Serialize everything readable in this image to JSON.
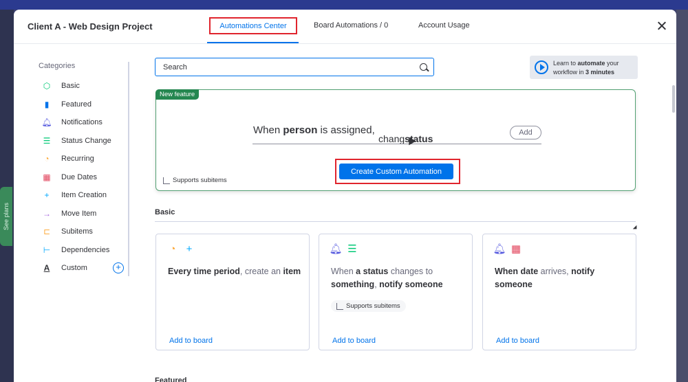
{
  "background": {
    "see_plans": "See plans"
  },
  "modal": {
    "title": "Client A - Web Design Project",
    "tabs": [
      {
        "label": "Automations Center",
        "active": true
      },
      {
        "label": "Board Automations / 0",
        "active": false
      },
      {
        "label": "Account Usage",
        "active": false
      }
    ]
  },
  "sidebar": {
    "heading": "Categories",
    "items": [
      {
        "label": "Basic",
        "icon": "cube-icon",
        "color": "#00c875"
      },
      {
        "label": "Featured",
        "icon": "bookmark-icon",
        "color": "#0073ea"
      },
      {
        "label": "Notifications",
        "icon": "bell-icon",
        "color": "#5559df"
      },
      {
        "label": "Status Change",
        "icon": "status-stack-icon",
        "color": "#00c875"
      },
      {
        "label": "Recurring",
        "icon": "clock-icon",
        "color": "#fdab3d"
      },
      {
        "label": "Due Dates",
        "icon": "calendar-icon",
        "color": "#e2445c"
      },
      {
        "label": "Item Creation",
        "icon": "plus-icon",
        "color": "#00a9ff"
      },
      {
        "label": "Move Item",
        "icon": "arrow-right-icon",
        "color": "#a25ddc"
      },
      {
        "label": "Subitems",
        "icon": "subitems-icon",
        "color": "#fdab3d"
      },
      {
        "label": "Dependencies",
        "icon": "dependency-icon",
        "color": "#00a9ff"
      },
      {
        "label": "Custom",
        "icon": "letter-a-icon",
        "color": "#323338"
      }
    ]
  },
  "search": {
    "placeholder": "Search"
  },
  "learn": {
    "prefix": "Learn to ",
    "bold1": "automate",
    "middle": " your workflow in ",
    "bold2": "3 minutes"
  },
  "feature": {
    "badge": "New feature",
    "sentence_pre": "When ",
    "sentence_bold": "person",
    "sentence_post": " is assigned,",
    "sentence2_pre": "chang",
    "sentence2_bold": "status",
    "add_label": "Add",
    "button_label": "Create Custom Automation",
    "subitems_label": "Supports subitems"
  },
  "basic_section": {
    "title": "Basic",
    "cards": [
      {
        "parts": [
          {
            "t": "Every time period",
            "b": true
          },
          {
            "t": ", create an ",
            "b": false,
            "light": true
          },
          {
            "t": "item",
            "b": true
          }
        ],
        "icons": [
          "clock-icon",
          "plus-icon"
        ],
        "subitems": "",
        "add": "Add to board"
      },
      {
        "parts": [
          {
            "t": "When ",
            "b": false,
            "light": true
          },
          {
            "t": "a status",
            "b": true
          },
          {
            "t": " changes to ",
            "b": false,
            "light": true
          },
          {
            "t": "something",
            "b": true
          },
          {
            "t": ", ",
            "b": false,
            "light": true
          },
          {
            "t": "notify someone",
            "b": true
          }
        ],
        "icons": [
          "bell-icon",
          "status-stack-icon"
        ],
        "subitems": "Supports subitems",
        "add": "Add to board"
      },
      {
        "parts": [
          {
            "t": "When date",
            "b": true
          },
          {
            "t": " arrives, ",
            "b": false,
            "light": true
          },
          {
            "t": "notify someone",
            "b": true
          }
        ],
        "icons": [
          "bell-icon",
          "calendar-icon"
        ],
        "subitems": "",
        "add": "Add to board"
      }
    ]
  },
  "featured_section": {
    "title": "Featured"
  },
  "colors": {
    "accent": "#0073ea",
    "highlight": "#e0242d",
    "feature_border": "#52a072",
    "badge": "#258750"
  }
}
